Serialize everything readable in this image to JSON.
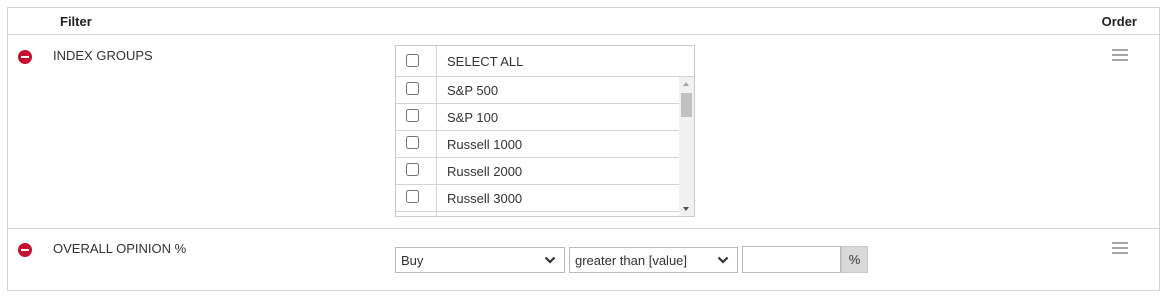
{
  "header": {
    "filter_label": "Filter",
    "order_label": "Order"
  },
  "index_groups": {
    "label": "INDEX GROUPS",
    "select_all_label": "SELECT ALL",
    "options": [
      {
        "label": "S&P 500",
        "checked": false
      },
      {
        "label": "S&P 100",
        "checked": false
      },
      {
        "label": "Russell 1000",
        "checked": false
      },
      {
        "label": "Russell 2000",
        "checked": false
      },
      {
        "label": "Russell 3000",
        "checked": false
      }
    ]
  },
  "overall_opinion": {
    "label": "OVERALL OPINION %",
    "opinion_selected": "Buy",
    "operator_selected": "greater than [value]",
    "value": "",
    "unit": "%"
  },
  "colors": {
    "remove_icon": "#c8102e",
    "border": "#d4d4d4",
    "handle": "#a6a6a6",
    "addon_bg": "#d9d9d9"
  },
  "icons": {
    "remove": "remove-circle-icon",
    "order": "drag-handle-icon",
    "dropdown": "chevron-down-icon"
  }
}
